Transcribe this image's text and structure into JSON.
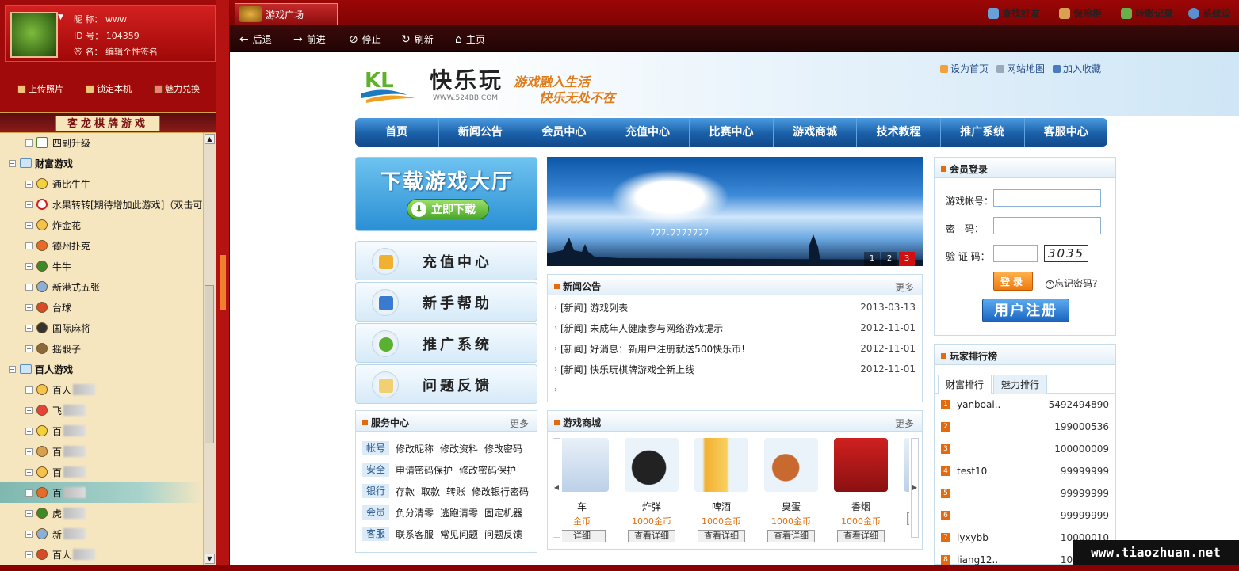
{
  "profile": {
    "nickname_label": "昵 称：",
    "nickname": "www",
    "id_label": "ID 号：",
    "id": "104359",
    "sign_label": "签 名：",
    "sign": "编辑个性签名"
  },
  "left_actions": [
    "上传照片",
    "锁定本机",
    "魅力兑换"
  ],
  "game_banner": "客龙棋牌游戏",
  "tree": [
    {
      "label": "四副升级",
      "level": 1,
      "icon": "check-icon"
    },
    {
      "label": "财富游戏",
      "level": 0,
      "icon": "folder-icon",
      "expanded": true
    },
    {
      "label": "通比牛牛",
      "level": 1,
      "icon": "cow-icon"
    },
    {
      "label": "水果转转[期待增加此游戏]（双击可",
      "level": 1,
      "icon": "stop-icon"
    },
    {
      "label": "炸金花",
      "level": 1,
      "icon": "flower-icon"
    },
    {
      "label": "德州扑克",
      "level": 1,
      "icon": "poker-icon"
    },
    {
      "label": "牛牛",
      "level": 1,
      "icon": "cow-icon"
    },
    {
      "label": "新港式五张",
      "level": 1,
      "icon": "card-icon"
    },
    {
      "label": "台球",
      "level": 1,
      "icon": "billiards-icon"
    },
    {
      "label": "国际麻将",
      "level": 1,
      "icon": "mahjong-icon"
    },
    {
      "label": "摇骰子",
      "level": 1,
      "icon": "dice-icon"
    },
    {
      "label": "百人游戏",
      "level": 0,
      "icon": "folder-icon",
      "expanded": true
    },
    {
      "label": "百人",
      "level": 1,
      "icon": "game-icon",
      "blurred": true
    },
    {
      "label": "飞",
      "level": 1,
      "icon": "game-icon",
      "blurred": true
    },
    {
      "label": "百",
      "level": 1,
      "icon": "game-icon",
      "blurred": true
    },
    {
      "label": "百",
      "level": 1,
      "icon": "game-icon",
      "blurred": true
    },
    {
      "label": "百",
      "level": 1,
      "icon": "game-icon",
      "blurred": true
    },
    {
      "label": "百",
      "level": 1,
      "icon": "game-icon",
      "blurred": true,
      "selected": true
    },
    {
      "label": "虎",
      "level": 1,
      "icon": "game-icon",
      "blurred": true
    },
    {
      "label": "新",
      "level": 1,
      "icon": "game-icon",
      "blurred": true
    },
    {
      "label": "百人",
      "level": 1,
      "icon": "globe-icon",
      "blurred": true
    }
  ],
  "tab": {
    "label": "游戏广场"
  },
  "top_links": [
    "查找好友",
    "保险柜",
    "转账记录",
    "系统设"
  ],
  "browser_nav": [
    "后退",
    "前进",
    "停止",
    "刷新",
    "主页"
  ],
  "site": {
    "logo_title": "快乐玩",
    "logo_url": "WWW.524BB.COM",
    "slogan1": "游戏融入生活",
    "slogan2": "快乐无处不在",
    "links": [
      "设为首页",
      "网站地图",
      "加入收藏"
    ],
    "nav": [
      "首页",
      "新闻公告",
      "会员中心",
      "充值中心",
      "比赛中心",
      "游戏商城",
      "技术教程",
      "推广系统",
      "客服中心"
    ],
    "download_title": "下载游戏大厅",
    "download_btn": "立即下载",
    "quick": [
      "充值中心",
      "新手帮助",
      "推广系统",
      "问题反馈"
    ],
    "banner_pages": [
      "1",
      "2",
      "3"
    ],
    "banner_text": "ﾌﾌﾌ.ﾌﾌﾌﾌﾌﾌﾌ"
  },
  "news": {
    "title": "新闻公告",
    "more": "更多",
    "items": [
      {
        "text": "[新闻] 游戏列表",
        "date": "2013-03-13"
      },
      {
        "text": "[新闻] 未成年人健康参与网络游戏提示",
        "date": "2012-11-01"
      },
      {
        "text": "[新闻] 好消息：新用户注册就送500快乐币!",
        "date": "2012-11-01"
      },
      {
        "text": "[新闻] 快乐玩棋牌游戏全新上线",
        "date": "2012-11-01"
      }
    ]
  },
  "service": {
    "title": "服务中心",
    "more": "更多",
    "rows": [
      {
        "tag": "帐号",
        "links": [
          "修改昵称",
          "修改资料",
          "修改密码"
        ]
      },
      {
        "tag": "安全",
        "links": [
          "申请密码保护",
          "修改密码保护"
        ]
      },
      {
        "tag": "银行",
        "links": [
          "存款",
          "取款",
          "转账",
          "修改银行密码"
        ]
      },
      {
        "tag": "会员",
        "links": [
          "负分清零",
          "逃跑清零",
          "固定机器"
        ]
      },
      {
        "tag": "客服",
        "links": [
          "联系客服",
          "常见问题",
          "问题反馈"
        ]
      }
    ]
  },
  "shop": {
    "title": "游戏商城",
    "more": "更多",
    "items": [
      {
        "name": "车",
        "price": "金币",
        "view": "详细"
      },
      {
        "name": "炸弹",
        "price": "1000金币",
        "view": "查看详细"
      },
      {
        "name": "啤酒",
        "price": "1000金币",
        "view": "查看详细"
      },
      {
        "name": "臭蛋",
        "price": "1000金币",
        "view": "查看详细"
      },
      {
        "name": "香烟",
        "price": "1000金币",
        "view": "查看详细"
      },
      {
        "name": "",
        "price": "1(",
        "view": "查"
      }
    ]
  },
  "login": {
    "title": "会员登录",
    "account_label": "游戏帐号：",
    "password_label": "密　码：",
    "captcha_label": "验 证 码：",
    "captcha": "3035",
    "login_btn": "登录",
    "forgot": "忘记密码?",
    "register_btn": "用户注册"
  },
  "rank": {
    "title": "玩家排行榜",
    "tabs": [
      "财富排行",
      "魅力排行"
    ],
    "rows": [
      {
        "no": "1",
        "name": "yanboai..",
        "value": "5492494890"
      },
      {
        "no": "2",
        "name": "",
        "value": "199000536"
      },
      {
        "no": "3",
        "name": "",
        "value": "100000009"
      },
      {
        "no": "4",
        "name": "test10",
        "value": "99999999"
      },
      {
        "no": "5",
        "name": "",
        "value": "99999999"
      },
      {
        "no": "6",
        "name": "",
        "value": "99999999"
      },
      {
        "no": "7",
        "name": "lyxybb",
        "value": "10000010"
      },
      {
        "no": "8",
        "name": "liang12..",
        "value": "10000010"
      }
    ]
  },
  "watermark": "www.tiaozhuan.net",
  "colors": {
    "frame_red": "#a10a0a",
    "nav_blue": "#1a5fa8",
    "accent_orange": "#e46a0f",
    "tree_bg": "#f5e6c0"
  }
}
